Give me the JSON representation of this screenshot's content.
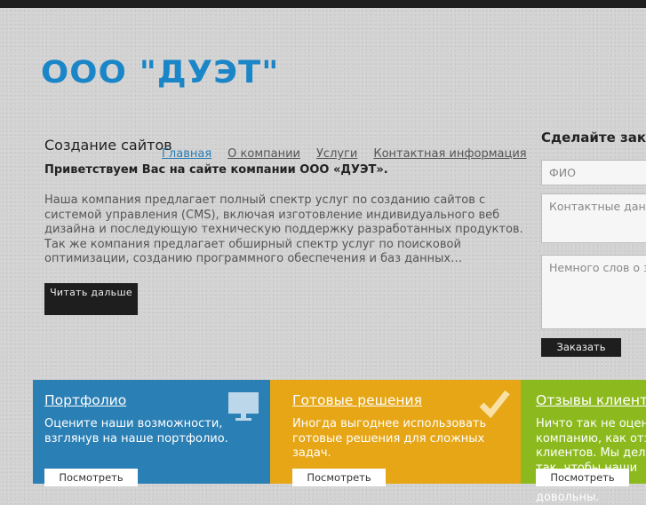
{
  "logo": {
    "text": "ООО \"ДУЭТ\""
  },
  "main": {
    "title": "Создание сайтов",
    "nav": [
      {
        "label": "Главная"
      },
      {
        "label": "О компании"
      },
      {
        "label": "Услуги"
      },
      {
        "label": "Контактная информация"
      }
    ],
    "welcome": "Приветствуем Вас на сайте компании ООО «ДУЭТ».",
    "description": "Наша компания предлагает полный спектр услуг по созданию сайтов с системой управления (CMS), включая изготовление индивидуального веб дизайна и последующую техническую поддержку разработанных продуктов. Так же компания предлагает обширный спектр услуг по поисковой оптимизации, созданию программного обеспечения и баз данных…",
    "read_more": "Читать дальше"
  },
  "order": {
    "title": "Сделайте заказ",
    "name_placeholder": "ФИО",
    "contacts_placeholder": "Контактные данные",
    "message_placeholder": "Немного слов о заказе",
    "submit": "Заказать"
  },
  "panels": [
    {
      "title": "Портфолио",
      "text": "Оцените наши возможности, взглянув на наше портфолио.",
      "button": "Посмотреть",
      "color": "#2a7fb5",
      "icon": "monitor-icon"
    },
    {
      "title": "Готовые решения",
      "text": "Иногда выгоднее использовать готовые решения для сложных задач.",
      "button": "Посмотреть",
      "color": "#e6a616",
      "icon": "checkmark-icon"
    },
    {
      "title": "Отзывы клиентов",
      "text": "Ничто так не оценит компанию, как отзывы клиентов. Мы делаем так, чтобы наши клиенты были довольны.",
      "button": "Посмотреть",
      "color": "#8cba1e",
      "icon": "comment-icon"
    }
  ]
}
